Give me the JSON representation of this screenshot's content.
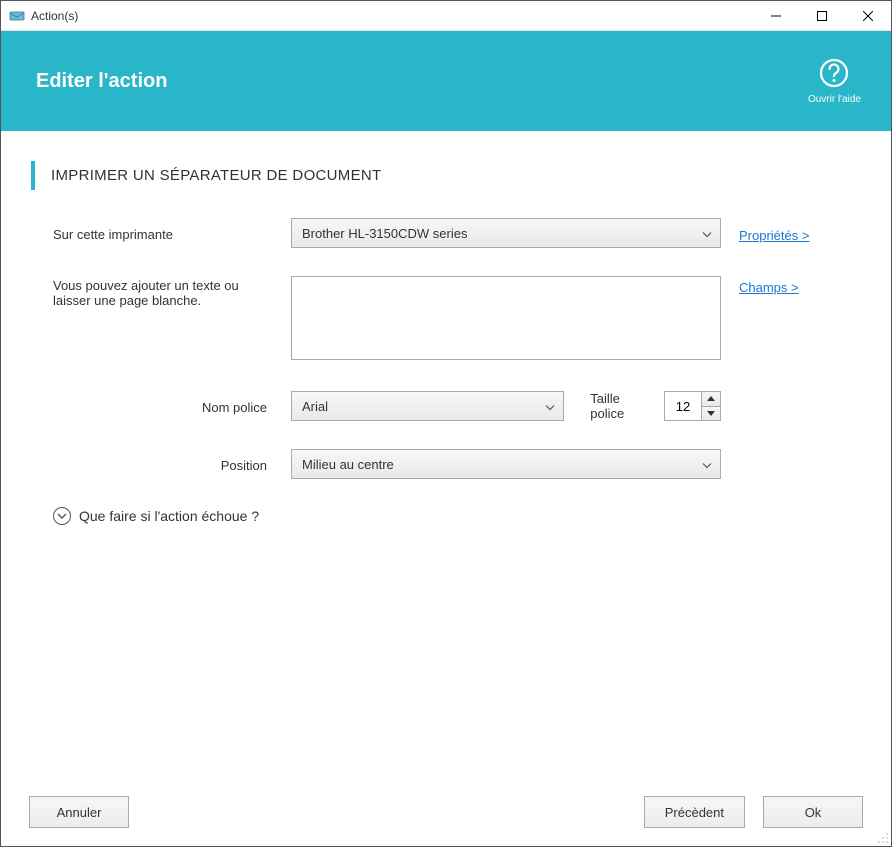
{
  "window": {
    "title": "Action(s)"
  },
  "header": {
    "title": "Editer l'action",
    "help_label": "Ouvrir l'aide"
  },
  "section": {
    "title": "IMPRIMER UN SÉPARATEUR DE DOCUMENT"
  },
  "form": {
    "printer_label": "Sur cette imprimante",
    "printer_value": "Brother HL-3150CDW series",
    "properties_link": "Propriétés >",
    "text_label": "Vous pouvez ajouter un texte ou laisser une page blanche.",
    "text_value": "",
    "fields_link": "Champs >",
    "font_name_label": "Nom police",
    "font_name_value": "Arial",
    "font_size_label": "Taille police",
    "font_size_value": "12",
    "position_label": "Position",
    "position_value": "Milieu au centre"
  },
  "collapsible": {
    "label": "Que faire si l'action échoue ?"
  },
  "footer": {
    "cancel": "Annuler",
    "previous": "Précèdent",
    "ok": "Ok"
  }
}
